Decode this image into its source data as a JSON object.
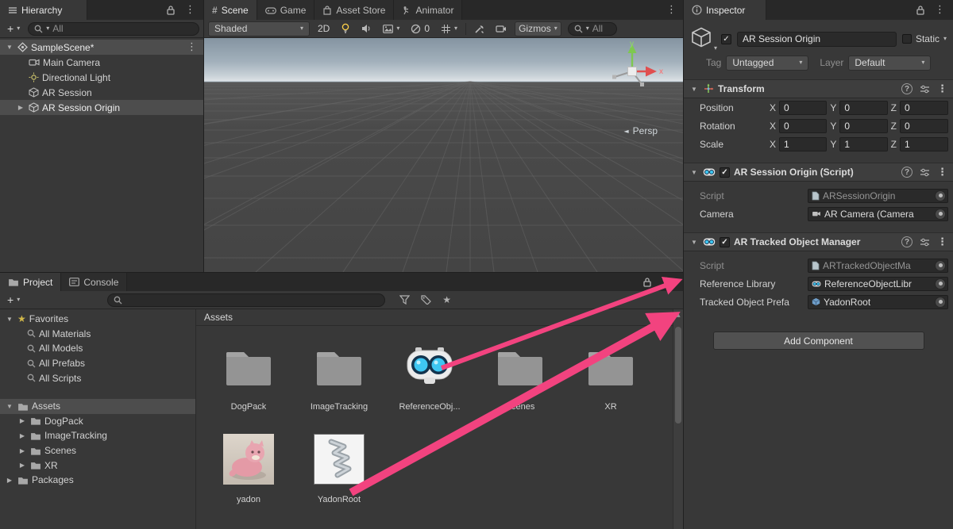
{
  "hierarchy": {
    "title": "Hierarchy",
    "search_label": "All",
    "scene_row": "SampleScene*",
    "items": [
      "Main Camera",
      "Directional Light",
      "AR Session",
      "AR Session Origin"
    ]
  },
  "scene": {
    "tabs": [
      "Scene",
      "Game",
      "Asset Store",
      "Animator"
    ],
    "toolbar": {
      "shading": "Shaded",
      "mode2d": "2D",
      "occlusion_count": "0",
      "gizmos": "Gizmos",
      "search_label": "All"
    },
    "persp_label": "Persp",
    "axis_x": "x",
    "axis_y": "y"
  },
  "inspector": {
    "title": "Inspector",
    "name_value": "AR Session Origin",
    "static_label": "Static",
    "tag_label": "Tag",
    "tag_value": "Untagged",
    "layer_label": "Layer",
    "layer_value": "Default",
    "transform": {
      "title": "Transform",
      "axes": [
        "X",
        "Y",
        "Z"
      ],
      "rows": [
        {
          "label": "Position",
          "x": "0",
          "y": "0",
          "z": "0"
        },
        {
          "label": "Rotation",
          "x": "0",
          "y": "0",
          "z": "0"
        },
        {
          "label": "Scale",
          "x": "1",
          "y": "1",
          "z": "1"
        }
      ]
    },
    "component1": {
      "title": "AR Session Origin (Script)",
      "script_label": "Script",
      "script_value": "ARSessionOrigin",
      "camera_label": "Camera",
      "camera_value": "AR Camera (Camera"
    },
    "component2": {
      "title": "AR Tracked Object Manager",
      "script_label": "Script",
      "script_value": "ARTrackedObjectMa",
      "reference_label": "Reference Library",
      "reference_value": "ReferenceObjectLibr",
      "prefab_label": "Tracked Object Prefa",
      "prefab_value": "YadonRoot"
    },
    "add_component_label": "Add Component"
  },
  "project": {
    "tabs": [
      "Project",
      "Console"
    ],
    "favorites_label": "Favorites",
    "favorites": [
      "All Materials",
      "All Models",
      "All Prefabs",
      "All Scripts"
    ],
    "assets_label": "Assets",
    "asset_folders": [
      "DogPack",
      "ImageTracking",
      "Scenes",
      "XR"
    ],
    "packages_label": "Packages",
    "breadcrumb": "Assets",
    "grid": [
      {
        "label": "DogPack"
      },
      {
        "label": "ImageTracking"
      },
      {
        "label": "ReferenceObj..."
      },
      {
        "label": "Scenes"
      },
      {
        "label": "XR"
      },
      {
        "label": "yadon"
      },
      {
        "label": "YadonRoot"
      }
    ]
  },
  "colors": {
    "accent_pink": "#f2437f",
    "selection": "#4d4d4d"
  }
}
